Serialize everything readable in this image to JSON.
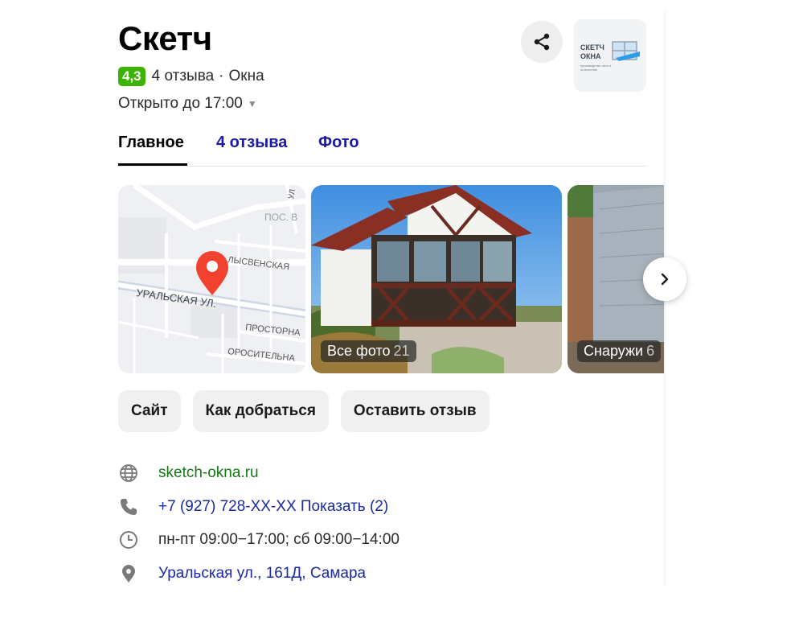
{
  "header": {
    "title": "Скетч",
    "rating": "4,3",
    "reviews_count": "4 отзыва",
    "separator": "·",
    "category": "Окна",
    "open_status": "Открыто до 17:00",
    "caret": "▼"
  },
  "logo": {
    "line1": "СКЕТЧ",
    "line2": "ОКНА",
    "small": "производство окон и остекление"
  },
  "tabs": [
    {
      "label": "Главное",
      "active": true
    },
    {
      "label": "4 отзыва",
      "active": false
    },
    {
      "label": "Фото",
      "active": false
    }
  ],
  "map": {
    "labels": [
      "ПОС. В",
      "ЛЫСВЕНСКАЯ",
      "УРАЛЬСКАЯ УЛ.",
      "ПРОСТОРНА",
      "ОРОСИТЕЛЬНА",
      "УЛ"
    ]
  },
  "gallery": {
    "photo1_caption": "Все фото",
    "photo1_count": "21",
    "photo2_caption": "Снаружи",
    "photo2_count": "6"
  },
  "actions": [
    "Сайт",
    "Как добраться",
    "Оставить отзыв"
  ],
  "info": {
    "website": "sketch-okna.ru",
    "phone": "+7 (927) 728-XX-XX Показать (2)",
    "hours": "пн-пт 09:00−17:00; сб 09:00−14:00",
    "address": "Уральская ул., 161Д, Самара"
  },
  "colors": {
    "rating_badge": "#3bb300",
    "link_blue": "#1a2ba3",
    "site_green": "#137a13",
    "pin_red": "#f0422f"
  },
  "icons": [
    "share-icon",
    "chevron-right-icon",
    "globe-icon",
    "phone-icon",
    "clock-icon",
    "location-pin-icon",
    "map-pin-icon"
  ]
}
